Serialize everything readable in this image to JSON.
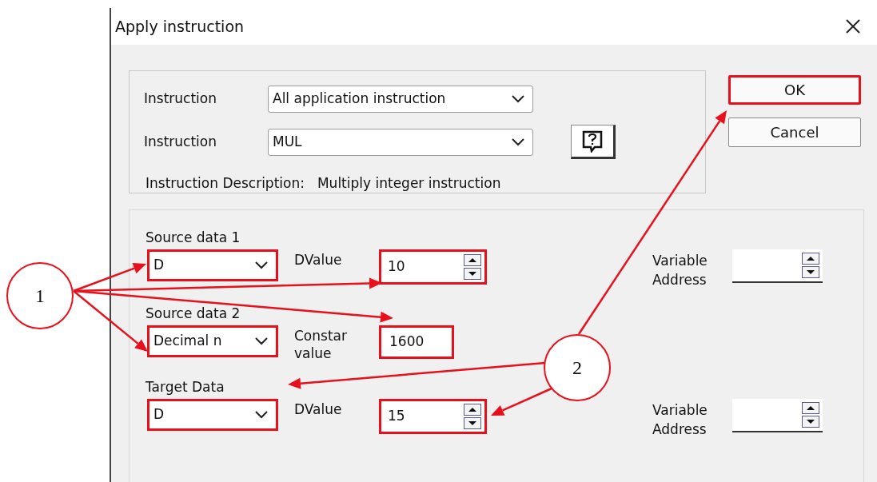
{
  "window": {
    "title": "Apply instruction"
  },
  "instruction_group": {
    "rows": [
      {
        "label": "Instruction",
        "value": "All application instruction",
        "highlighted": false
      },
      {
        "label": "Instruction",
        "value": "MUL",
        "highlighted": false
      }
    ],
    "description_label": "Instruction Description:",
    "description": "Multiply integer instruction"
  },
  "buttons": [
    {
      "label": "OK",
      "highlighted": true
    },
    {
      "label": "Cancel",
      "highlighted": false
    }
  ],
  "operands": [
    {
      "title": "Source data 1",
      "kind": "spin",
      "type": {
        "value": "D",
        "highlighted": true
      },
      "value_label": "DValue",
      "value": {
        "text": "10",
        "highlighted": true
      },
      "address_label": "Variable Address"
    },
    {
      "title": "Source data 2",
      "kind": "plain",
      "type": {
        "value": "Decimal n",
        "highlighted": true
      },
      "value_label": "Constar value",
      "value": {
        "text": "1600",
        "highlighted": true
      }
    },
    {
      "title": "Target Data",
      "kind": "spin",
      "type": {
        "value": "D",
        "highlighted": true
      },
      "value_label": "DValue",
      "value": {
        "text": "15",
        "highlighted": true
      },
      "address_label": "Variable Address"
    }
  ],
  "callouts": [
    {
      "label": "1"
    },
    {
      "label": "2"
    }
  ]
}
